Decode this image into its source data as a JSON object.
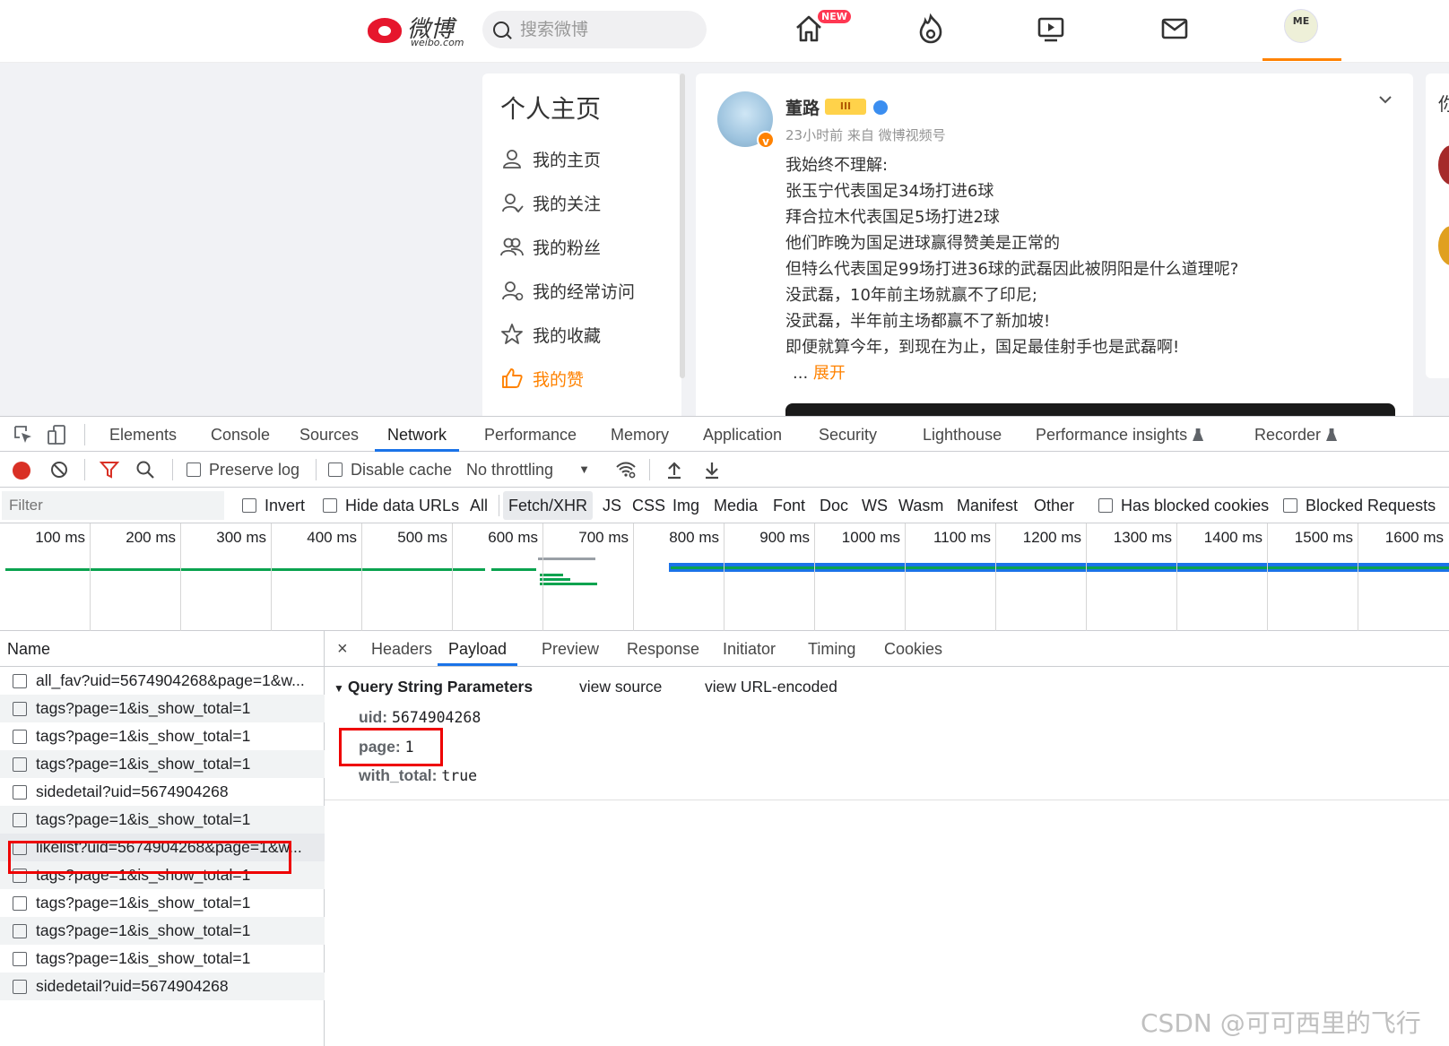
{
  "weibo": {
    "logo_text": "微博",
    "logo_sub": "weibo.com",
    "search_placeholder": "搜索微博",
    "new_badge": "NEW",
    "avatar_text": "ME",
    "accent": "#ff8200",
    "sidebar": {
      "title": "个人主页",
      "items": [
        {
          "label": "我的主页",
          "icon": "user-icon"
        },
        {
          "label": "我的关注",
          "icon": "user-follow-icon"
        },
        {
          "label": "我的粉丝",
          "icon": "users-icon"
        },
        {
          "label": "我的经常访问",
          "icon": "user-visit-icon"
        },
        {
          "label": "我的收藏",
          "icon": "star-icon"
        },
        {
          "label": "我的赞",
          "icon": "thumbs-up-icon"
        }
      ]
    },
    "post": {
      "author": "董路",
      "level_badge": "III",
      "meta": "23小时前 来自 微博视频号",
      "verified": "v",
      "lines": [
        "我始终不理解:",
        "张玉宁代表国足34场打进6球",
        "拜合拉木代表国足5场打进2球",
        "他们昨晚为国足进球赢得赞美是正常的",
        "但特么代表国足99场打进36球的武磊因此被阴阳是什么道理呢?",
        "没武磊，10年前主场就赢不了印尼;",
        "没武磊，半年前主场都赢不了新加坡!",
        "即便就算今年，到现在为止，国足最佳射手也是武磊啊!"
      ],
      "ellipsis": "...",
      "expand": "展开"
    },
    "right_card_char": "你"
  },
  "devtools": {
    "tabs": [
      "Elements",
      "Console",
      "Sources",
      "Network",
      "Performance",
      "Memory",
      "Application",
      "Security",
      "Lighthouse",
      "Performance insights",
      "Recorder"
    ],
    "active_tab": "Network",
    "toolbar": {
      "preserve_log": "Preserve log",
      "disable_cache": "Disable cache",
      "throttling": "No throttling"
    },
    "filter": {
      "placeholder": "Filter",
      "invert": "Invert",
      "hide_data_urls": "Hide data URLs",
      "types": [
        "All",
        "Fetch/XHR",
        "JS",
        "CSS",
        "Img",
        "Media",
        "Font",
        "Doc",
        "WS",
        "Wasm",
        "Manifest",
        "Other"
      ],
      "selected_type": "Fetch/XHR",
      "has_blocked_cookies": "Has blocked cookies",
      "blocked_requests": "Blocked Requests"
    },
    "timeline_ticks": [
      "100 ms",
      "200 ms",
      "300 ms",
      "400 ms",
      "500 ms",
      "600 ms",
      "700 ms",
      "800 ms",
      "900 ms",
      "1000 ms",
      "1100 ms",
      "1200 ms",
      "1300 ms",
      "1400 ms",
      "1500 ms",
      "1600 ms"
    ],
    "name_header": "Name",
    "requests": [
      "all_fav?uid=5674904268&page=1&w...",
      "tags?page=1&is_show_total=1",
      "tags?page=1&is_show_total=1",
      "tags?page=1&is_show_total=1",
      "sidedetail?uid=5674904268",
      "tags?page=1&is_show_total=1",
      "likelist?uid=5674904268&page=1&w...",
      "tags?page=1&is_show_total=1",
      "tags?page=1&is_show_total=1",
      "tags?page=1&is_show_total=1",
      "tags?page=1&is_show_total=1",
      "sidedetail?uid=5674904268"
    ],
    "detail_tabs": [
      "Headers",
      "Payload",
      "Preview",
      "Response",
      "Initiator",
      "Timing",
      "Cookies"
    ],
    "active_detail_tab": "Payload",
    "close": "×",
    "query": {
      "title": "Query String Parameters",
      "view_source": "view source",
      "view_url_encoded": "view URL-encoded",
      "params": [
        {
          "key": "uid:",
          "value": "5674904268"
        },
        {
          "key": "page:",
          "value": "1"
        },
        {
          "key": "with_total:",
          "value": "true"
        }
      ]
    },
    "highlight_color": "#e00000",
    "selection_blue": "#1a73e8"
  },
  "watermark": "CSDN @可可西里的飞行"
}
